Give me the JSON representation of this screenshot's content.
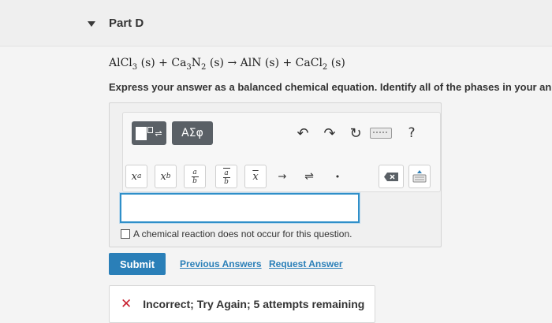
{
  "part": {
    "title": "Part D"
  },
  "question": {
    "equation_parts": {
      "r1": "AlCl",
      "r1_sub": "3",
      "r1_phase": "(s)",
      "plus1": "+",
      "r2a": "Ca",
      "r2a_sub": "3",
      "r2b": "N",
      "r2b_sub": "2",
      "r2_phase": "(s)",
      "arrow": "→",
      "p1": "AlN",
      "p1_phase": "(s)",
      "plus2": "+",
      "p2": "CaCl",
      "p2_sub": "2",
      "p2_phase": "(s)"
    },
    "instruction": "Express your answer as a balanced chemical equation. Identify all of the phases in your an"
  },
  "toolbar": {
    "greek_label": "ΑΣφ",
    "help_label": "?",
    "superscript_base": "x",
    "superscript_exp": "a",
    "subscript_base": "x",
    "subscript_sub": "b",
    "frac_num": "a",
    "frac_den": "b",
    "overline_label": "x",
    "arrow_label": "→",
    "equilibrium_label": "⇌",
    "dot_label": "•"
  },
  "answer": {
    "value": ""
  },
  "no_reaction": {
    "label": "A chemical reaction does not occur for this question.",
    "checked": false
  },
  "actions": {
    "submit_label": "Submit",
    "previous_answers_label": "Previous Answers",
    "request_answer_label": "Request Answer"
  },
  "feedback": {
    "icon": "x-icon",
    "message": "Incorrect; Try Again; 5 attempts remaining",
    "color": "#c8202f"
  },
  "colors": {
    "accent": "#2a7fb8",
    "input_border": "#2f8fc9",
    "dark_button": "#5a6066"
  }
}
